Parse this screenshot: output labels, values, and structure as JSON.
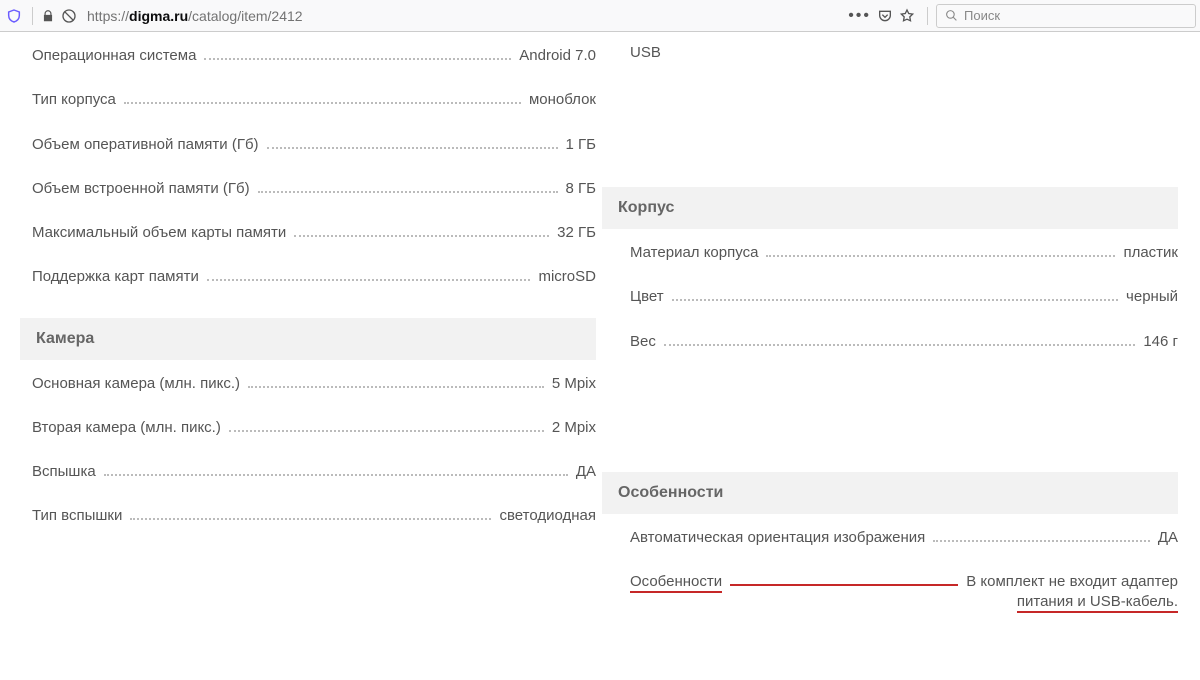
{
  "browser": {
    "url_protocol": "https://",
    "url_domain": "digma.ru",
    "url_path": "/catalog/item/2412",
    "search_placeholder": "Поиск"
  },
  "right_top_value": "USB",
  "left": {
    "rows": [
      {
        "label": "Операционная система",
        "value": "Android 7.0"
      },
      {
        "label": "Тип корпуса",
        "value": "моноблок"
      },
      {
        "label": "Объем оперативной памяти (Гб)",
        "value": "1 ГБ"
      },
      {
        "label": "Объем встроенной памяти (Гб)",
        "value": "8 ГБ"
      },
      {
        "label": "Максимальный объем карты памяти",
        "value": "32 ГБ"
      },
      {
        "label": "Поддержка карт памяти",
        "value": "microSD"
      }
    ],
    "camera_header": "Камера",
    "camera_rows": [
      {
        "label": "Основная камера (млн. пикс.)",
        "value": "5 Mpix"
      },
      {
        "label": "Вторая камера (млн. пикс.)",
        "value": "2 Mpix"
      },
      {
        "label": "Вспышка",
        "value": "ДА"
      },
      {
        "label": "Тип вспышки",
        "value": "светодиодная"
      }
    ]
  },
  "right": {
    "body_header": "Корпус",
    "body_rows": [
      {
        "label": "Материал корпуса",
        "value": "пластик"
      },
      {
        "label": "Цвет",
        "value": "черный"
      },
      {
        "label": "Вес",
        "value": "146 г"
      }
    ],
    "features_header": "Особенности",
    "features_rows": [
      {
        "label": "Автоматическая ориентация изображения",
        "value": "ДА"
      }
    ],
    "special_label": "Особенности",
    "special_value_line1": "В комплект не входит адаптер",
    "special_value_line2": "питания и USB-кабель."
  }
}
